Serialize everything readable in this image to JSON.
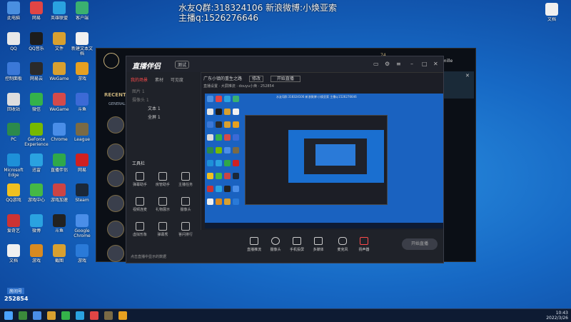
{
  "overlay": {
    "line1": "水友Q群:318324106 新浪微博:小焕亚索",
    "line2": "主播q:1526276646"
  },
  "desktop_icons": [
    {
      "label": "此电脑",
      "color": "#4a8fe0"
    },
    {
      "label": "网易",
      "color": "#e04545"
    },
    {
      "label": "英雄联盟",
      "color": "#2aa2e0"
    },
    {
      "label": "客户端",
      "color": "#3ab070"
    },
    {
      "label": "QQ",
      "color": "#e8e8e8"
    },
    {
      "label": "QQ音乐",
      "color": "#1c1c1c"
    },
    {
      "label": "文件",
      "color": "#d8a030"
    },
    {
      "label": "新建文本文档",
      "color": "#f0f0f0"
    },
    {
      "label": "控制面板",
      "color": "#3b78d8"
    },
    {
      "label": "网易云",
      "color": "#2a2a2a"
    },
    {
      "label": "WeGame",
      "color": "#d8a030"
    },
    {
      "label": "游戏",
      "color": "#e6a020"
    },
    {
      "label": "回收站",
      "color": "#dddddd"
    },
    {
      "label": "微信",
      "color": "#34b24a"
    },
    {
      "label": "WeGame",
      "color": "#d44a4a"
    },
    {
      "label": "斗鱼",
      "color": "#3c6ad6"
    },
    {
      "label": "PC",
      "color": "#2c8a4c"
    },
    {
      "label": "GeForce Experience",
      "color": "#76b900"
    },
    {
      "label": "Chrome",
      "color": "#4a8ee8"
    },
    {
      "label": "League",
      "color": "#7a6a45"
    },
    {
      "label": "Microsoft Edge",
      "color": "#1e90d8"
    },
    {
      "label": "迅雷",
      "color": "#2aa2e0"
    },
    {
      "label": "直播伴侣",
      "color": "#2fa84a"
    },
    {
      "label": "网易",
      "color": "#d02020"
    },
    {
      "label": "QQ游戏",
      "color": "#f0c020"
    },
    {
      "label": "游戏中心",
      "color": "#45b845"
    },
    {
      "label": "游戏加速",
      "color": "#cc4444"
    },
    {
      "label": "Steam",
      "color": "#1b2838"
    },
    {
      "label": "爱奇艺",
      "color": "#cc3333"
    },
    {
      "label": "微博",
      "color": "#2aa2e0"
    },
    {
      "label": "斗鱼",
      "color": "#222222"
    },
    {
      "label": "Google Chrome",
      "color": "#4a8ee8"
    },
    {
      "label": "文档",
      "color": "#f0f0f0"
    },
    {
      "label": "游戏",
      "color": "#d88a20"
    },
    {
      "label": "截图",
      "color": "#d8a030"
    },
    {
      "label": "游戏",
      "color": "#2a7ad8"
    }
  ],
  "right_icon_label": "文档",
  "league": {
    "recent_label": "RECENT G",
    "general_label": "GENERAL",
    "camille_label": "amille",
    "level_label": "74"
  },
  "obs": {
    "logo": "直播伴侣",
    "version": "测试",
    "tabs": [
      "我的场景",
      "素材",
      "可见度"
    ],
    "scenes": [
      "图片 1",
      "摄像头 1",
      "文本 1",
      "全屏 1"
    ],
    "tool_title": "工具栏",
    "tools": [
      "弹幕助手",
      "房管助手",
      "主播任务",
      "视频连麦",
      "礼物展示",
      "摄像头",
      "虚拟形象",
      "弹幕秀",
      "答问排行"
    ],
    "hint": "点击直播中显示的数据",
    "room_title": "广东小镇的重生之路",
    "room_tag": "修改",
    "room_button": "开始直播",
    "room_info": "直播设置 · 大屏推流 · douyu小焕 · 252854",
    "preview_text": "水友Q群:318324106 新浪微博:小焕亚索 主播q:1526276646",
    "bottom_buttons": [
      "直播推流",
      "摄像头",
      "手机投屏",
      "多媒体",
      "麦克风",
      "扬声器"
    ],
    "start_button": "开始直播"
  },
  "room_id_label": "房间号",
  "room_id": "252854",
  "tray": {
    "time": "10:43",
    "date": "2022/3/26"
  }
}
